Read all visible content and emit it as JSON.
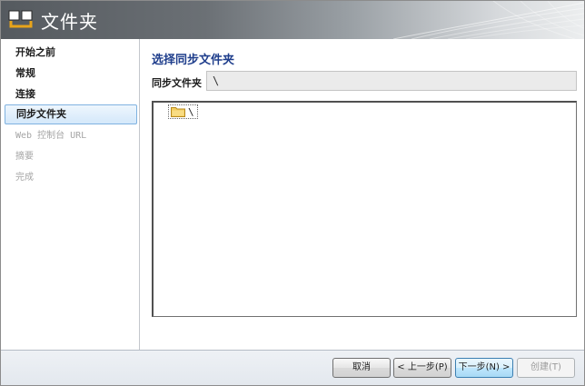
{
  "window": {
    "title": "文件夹"
  },
  "sidebar": {
    "items": [
      {
        "label": "开始之前",
        "state": "normal"
      },
      {
        "label": "常规",
        "state": "normal"
      },
      {
        "label": "连接",
        "state": "normal"
      },
      {
        "label": "同步文件夹",
        "state": "active"
      },
      {
        "label": "Web 控制台 URL",
        "state": "disabled"
      },
      {
        "label": "摘要",
        "state": "disabled"
      },
      {
        "label": "完成",
        "state": "disabled"
      }
    ]
  },
  "main": {
    "section_title": "选择同步文件夹",
    "sync_folder_label": "同步文件夹",
    "sync_folder_value": "\\",
    "tree": {
      "root": {
        "icon": "folder-icon",
        "label": "\\"
      }
    }
  },
  "footer": {
    "cancel_label": "取消",
    "back_label": "< 上一步(P)",
    "next_label": "下一步(N) >",
    "create_label": "创建(T)"
  },
  "colors": {
    "accent_title": "#1f3e8c",
    "active_nav_border": "#7fb2e0",
    "active_nav_bg": "#d4e8fa",
    "header_dark": "#555a5f",
    "disabled_text": "#a5a5a5"
  }
}
